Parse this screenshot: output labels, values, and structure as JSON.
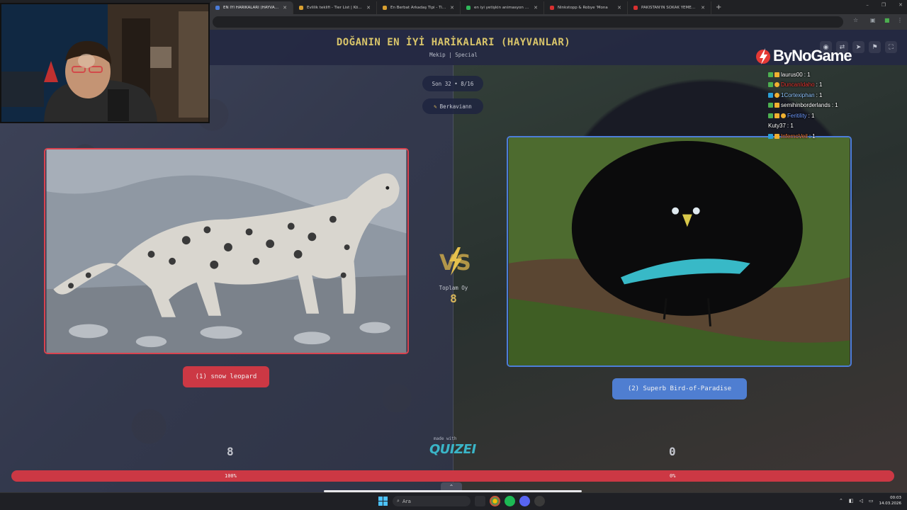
{
  "browser": {
    "tabs": [
      {
        "label": "EN İYİ HARİKALARI (HAYVANLAR)",
        "active": true,
        "color": "#4a7bd8"
      },
      {
        "label": "Evlilik teklifi - Tier List | Kör Sıra",
        "active": false,
        "color": "#d9a030"
      },
      {
        "label": "En Berbat Arkadaş Tipi - Tier Li",
        "active": false,
        "color": "#d9a030"
      },
      {
        "label": "en iyi yetişkin animasyon dizisi",
        "active": false,
        "color": "#2fb85a"
      },
      {
        "label": "Ninkstopp & Robye 'Mona",
        "active": false,
        "color": "#d93030"
      },
      {
        "label": "PAKİSTAN'IN SOKAK YEMEKLE",
        "active": false,
        "color": "#d93030"
      }
    ],
    "new_tab": "+",
    "window_controls": [
      "–",
      "❐",
      "✕"
    ]
  },
  "header": {
    "title": "DOĞANIN EN İYİ HARİKALARI (HAYVANLAR)",
    "subtitle": "Mekip | Special",
    "icons": [
      "eye-icon",
      "share-icon",
      "send-icon",
      "flag-icon",
      "fullscreen-icon"
    ]
  },
  "round": {
    "label": "Son 32 • 8/16",
    "user": "Berkaviann"
  },
  "matchup": {
    "left": {
      "label": "(1) snow leopard",
      "score": "8",
      "percent": "100%",
      "percent_value": 100,
      "color": "#cc3844"
    },
    "right": {
      "label": "(2) Superb Bird-of-Paradise",
      "score": "0",
      "percent": "0%",
      "percent_value": 0,
      "color": "#4f7ed1"
    },
    "votes_label": "Toplam Oy",
    "votes_total": "8"
  },
  "branding": {
    "made_with": "made with",
    "quizei": "QUIZEI",
    "logo": "ByNoGame"
  },
  "chat": [
    {
      "name": "laurus00",
      "count": ": 1",
      "color": "#ffffff"
    },
    {
      "name": "DuncanIdaho",
      "count": ": 1",
      "color": "#e8332f"
    },
    {
      "name": "1Cortexiphan",
      "count": ": 1",
      "color": "#8fc4ff"
    },
    {
      "name": "semihinborderlands",
      "count": ": 1",
      "color": "#ffffff"
    },
    {
      "name": "Feritility",
      "count": ": 1",
      "color": "#6f9bff"
    },
    {
      "name": "Kuty37",
      "count": ": 1",
      "color": "#ffffff"
    },
    {
      "name": "InfernoVeil",
      "count": ": 1",
      "color": "#ff7a2f"
    }
  ],
  "taskbar": {
    "search": "Ara",
    "time": "00:03",
    "date": "14.03.2026"
  }
}
